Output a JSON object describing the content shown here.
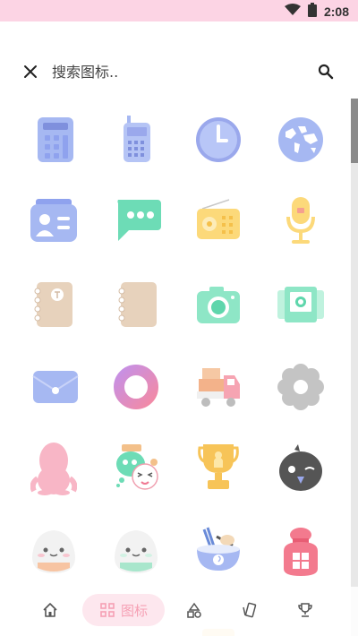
{
  "status_bar": {
    "time": "2:08",
    "icons": [
      "wifi-icon",
      "battery-icon"
    ]
  },
  "search": {
    "placeholder": "搜索图标.."
  },
  "bottom_nav": {
    "items": [
      "home-icon",
      "icons-tab",
      "shapes-icon",
      "cards-icon",
      "trophy-icon"
    ],
    "active_label": "图标"
  },
  "grid": {
    "icons": [
      "calculator-icon",
      "mobile-phone-icon",
      "clock-icon",
      "globe-icon",
      "contact-card-icon",
      "message-icon",
      "radio-icon",
      "microphone-icon",
      "notebook-icon",
      "notebook-plain-icon",
      "camera-icon",
      "gallery-camera-icon",
      "envelope-icon",
      "ring-icon",
      "delivery-truck-icon",
      "settings-gear-icon",
      "penguin-icon",
      "chat-app-icon",
      "trophy-icon",
      "crow-icon",
      "rice-ball-icon",
      "rice-ball-green-icon",
      "noodle-bowl-icon",
      "lucky-bag-icon"
    ]
  },
  "colors": {
    "accent": "#f6a0b4",
    "status_bar": "#fcd4e4"
  }
}
